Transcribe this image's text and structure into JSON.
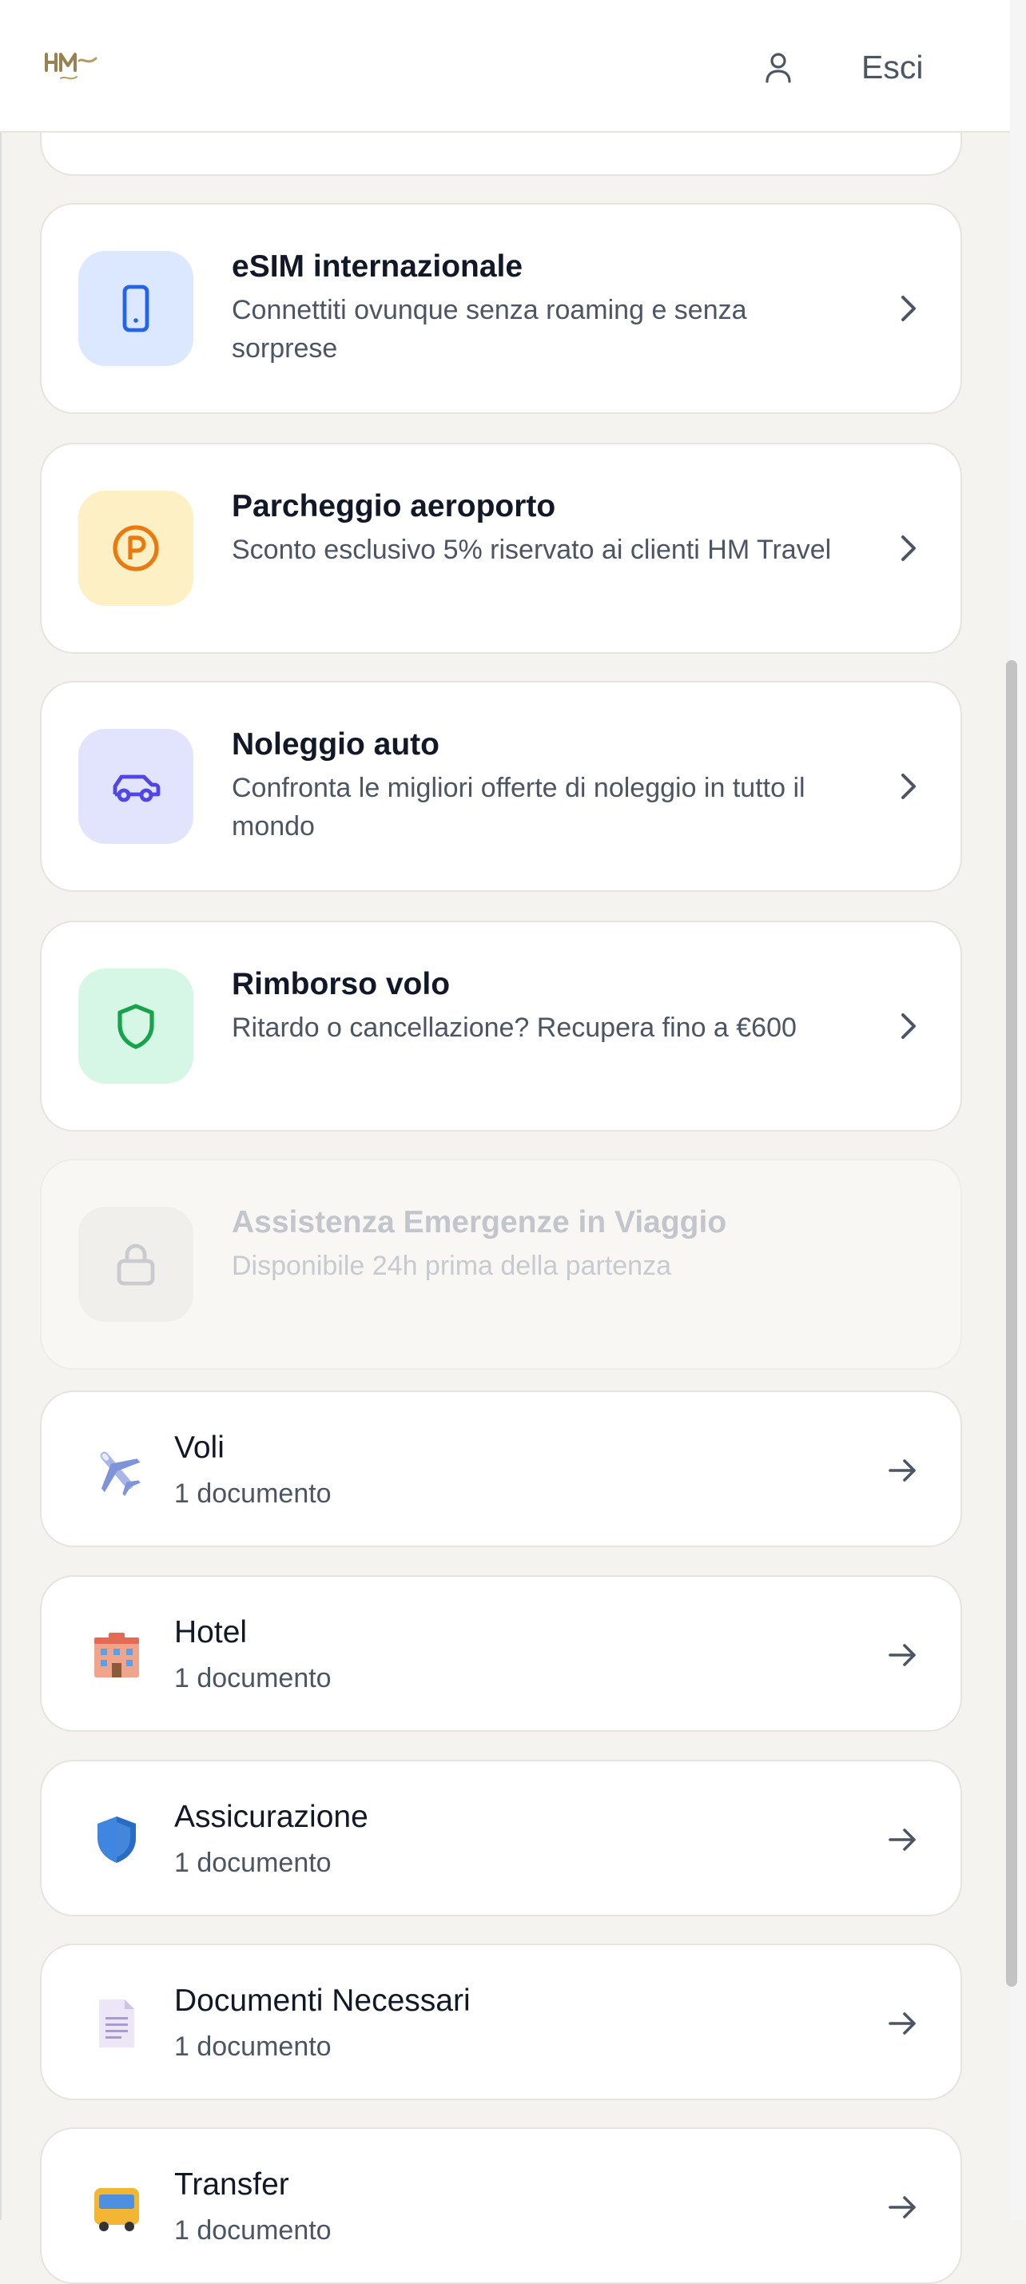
{
  "header": {
    "logo_icon": "hm-travel-logo",
    "user_icon": "user-icon",
    "logout_label": "Esci"
  },
  "services": [
    {
      "id": "esim",
      "title": "eSIM internazionale",
      "description": "Connettiti ovunque senza roaming e senza sorprese",
      "icon": "smartphone-icon",
      "tile_color": "#dbe8ff",
      "icon_color": "#2563eb",
      "enabled": true
    },
    {
      "id": "parking",
      "title": "Parcheggio aeroporto",
      "description": "Sconto esclusivo 5% riservato ai clienti HM Travel",
      "icon": "parking-icon",
      "tile_color": "#fdf0c4",
      "icon_color": "#ea7a0f",
      "enabled": true
    },
    {
      "id": "car",
      "title": "Noleggio auto",
      "description": "Confronta le migliori offerte di noleggio in tutto il mondo",
      "icon": "car-icon",
      "tile_color": "#e2e4fd",
      "icon_color": "#4f46e5",
      "enabled": true
    },
    {
      "id": "refund",
      "title": "Rimborso volo",
      "description": "Ritardo o cancellazione? Recupera fino a €600",
      "icon": "shield-icon",
      "tile_color": "#d6f6e6",
      "icon_color": "#16a34a",
      "enabled": true
    },
    {
      "id": "assistance",
      "title": "Assistenza Emergenze in Viaggio",
      "description": "Disponibile 24h prima della partenza",
      "icon": "lock-icon",
      "tile_color": "#f0efec",
      "icon_color": "#c9cbcf",
      "enabled": false
    }
  ],
  "documents": [
    {
      "id": "voli",
      "title": "Voli",
      "count_label": "1 documento",
      "icon": "airplane-icon"
    },
    {
      "id": "hotel",
      "title": "Hotel",
      "count_label": "1 documento",
      "icon": "hotel-icon"
    },
    {
      "id": "insurance",
      "title": "Assicurazione",
      "count_label": "1 documento",
      "icon": "shield-icon"
    },
    {
      "id": "docs",
      "title": "Documenti Necessari",
      "count_label": "1 documento",
      "icon": "document-icon"
    },
    {
      "id": "transfer",
      "title": "Transfer",
      "count_label": "1 documento",
      "icon": "bus-icon"
    }
  ]
}
